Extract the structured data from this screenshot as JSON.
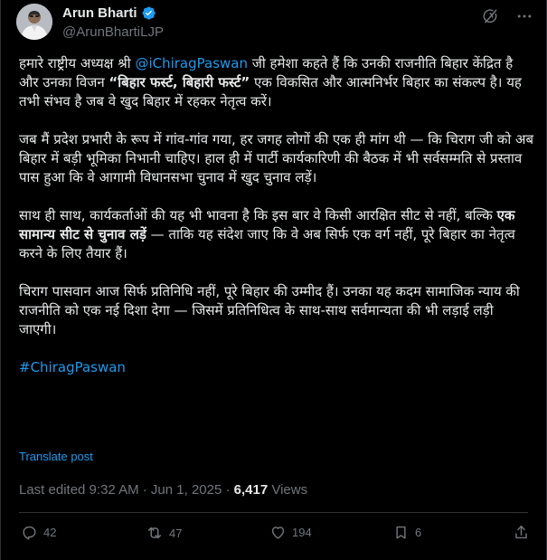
{
  "author": {
    "name": "Arun Bharti",
    "handle": "@ArunBhartiLJP",
    "verified": true,
    "verified_color": "#1d9bf0"
  },
  "top_actions": {
    "grok_icon": "grok-icon",
    "more_icon": "more-icon"
  },
  "post": {
    "p1_pre": "हमारे राष्ट्रीय अध्यक्ष श्री ",
    "p1_mention": "@iChiragPaswan",
    "p1_mid": " जी हमेशा कहते हैं कि उनकी राजनीति बिहार केंद्रित है और उनका विजन ",
    "p1_bold": "“बिहार फर्स्ट, बिहारी फर्स्ट”",
    "p1_post": " एक विकसित और आत्मनिर्भर बिहार का संकल्प है। यह तभी संभव है जब वे खुद बिहार में रहकर नेतृत्व करें।",
    "p2": "जब मैं प्रदेश प्रभारी के रूप में गांव-गांव गया, हर जगह लोगों की एक ही मांग थी — कि चिराग जी को अब बिहार में बड़ी भूमिका निभानी चाहिए। हाल ही में पार्टी कार्यकारिणी की बैठक में भी सर्वसम्मति से प्रस्ताव पास हुआ कि वे आगामी विधानसभा चुनाव में खुद चुनाव लड़ें।",
    "p3_pre": "साथ ही साथ, कार्यकर्ताओं की यह भी भावना है कि इस बार वे किसी आरक्षित सीट से नहीं, बल्कि ",
    "p3_bold": "एक सामान्य सीट से चुनाव लड़ें",
    "p3_post": " — ताकि यह संदेश जाए कि वे अब सिर्फ एक वर्ग नहीं, पूरे बिहार का नेतृत्व करने के लिए तैयार हैं।",
    "p4": "चिराग पासवान आज सिर्फ प्रतिनिधि नहीं, पूरे बिहार की उम्मीद हैं। उनका यह कदम सामाजिक न्याय की राजनीति को एक नई दिशा देगा — जिसमें प्रतिनिधित्व के साथ-साथ सर्वमान्यता की भी लड़ाई लड़ी जाएगी।",
    "hashtag": "#ChiragPaswan",
    "translate_label": "Translate post"
  },
  "meta": {
    "edited": "Last edited 9:32 AM · Jun 1, 2025 · ",
    "views_count": "6,417",
    "views_label": " Views"
  },
  "actions": {
    "replies": "42",
    "reposts": "47",
    "likes": "194",
    "bookmarks": "6"
  },
  "colors": {
    "background": "#000000",
    "text": "#e7e9ea",
    "muted": "#71767b",
    "accent": "#1d9bf0"
  }
}
